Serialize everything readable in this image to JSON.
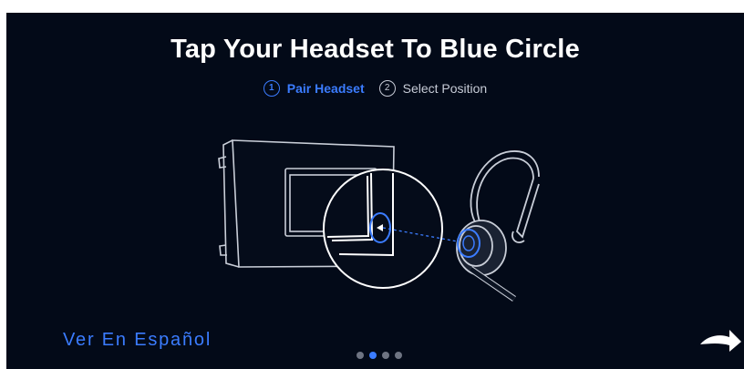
{
  "title": "Tap Your Headset To Blue Circle",
  "steps": [
    {
      "number": "1",
      "label": "Pair Headset",
      "state": "active"
    },
    {
      "number": "2",
      "label": "Select Position",
      "state": "inactive"
    }
  ],
  "spanish_link": "Ver En Español",
  "pagination": {
    "total": 4,
    "current": 2
  },
  "icons": {
    "next": "next-arrow-icon"
  },
  "colors": {
    "background": "#030a18",
    "accent": "#3b7cff",
    "text": "#ffffff",
    "muted": "#c7ccd7"
  }
}
